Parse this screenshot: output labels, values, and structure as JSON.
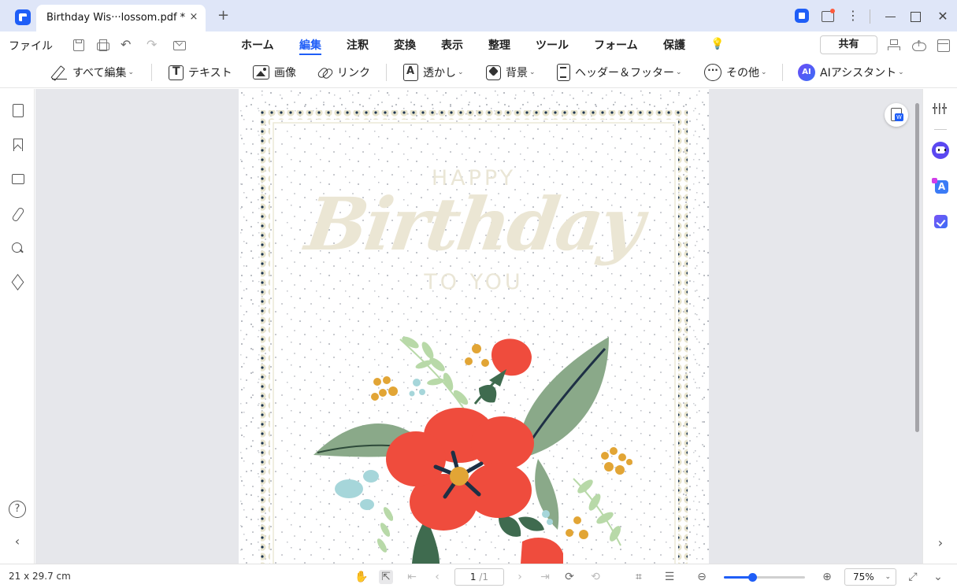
{
  "window": {
    "tab_title": "Birthday  Wis···lossom.pdf *",
    "tab_close": "×",
    "new_tab": "+"
  },
  "menu": {
    "file": "ファイル",
    "tabs": [
      {
        "label": "ホーム",
        "active": false
      },
      {
        "label": "編集",
        "active": true
      },
      {
        "label": "注釈",
        "active": false
      },
      {
        "label": "変換",
        "active": false
      },
      {
        "label": "表示",
        "active": false
      },
      {
        "label": "整理",
        "active": false
      },
      {
        "label": "ツール",
        "active": false
      },
      {
        "label": "フォーム",
        "active": false
      },
      {
        "label": "保護",
        "active": false
      }
    ],
    "share": "共有"
  },
  "ribbon": {
    "edit_all": "すべて編集",
    "text": "テキスト",
    "image": "画像",
    "link": "リンク",
    "watermark": "透かし",
    "background": "背景",
    "header_footer": "ヘッダー＆フッター",
    "more": "その他",
    "ai_assistant": "AIアシスタント",
    "ai_badge": "AI",
    "chevron": "⌄"
  },
  "document": {
    "happy": "HAPPY",
    "birthday": "Birthday",
    "to_you": "TO YOU"
  },
  "status": {
    "page_size": "21 x 29.7 cm",
    "current_page": "1",
    "total_pages": "/1",
    "zoom": "75%",
    "zoom_level": 0.35
  },
  "colors": {
    "accent": "#1f5ef7",
    "flower_red": "#ef4c3d",
    "leaf_green": "#8aa989",
    "dark_leaf": "#3f6b4f",
    "gold": "#e2a535",
    "light_blue": "#a6d6da",
    "border_cream": "#e9e4cf"
  },
  "icons": [
    "app-logo-icon",
    "pdf-icon",
    "message-icon",
    "kebab-icon",
    "save-icon",
    "print-icon",
    "undo-icon",
    "redo-icon",
    "mail-icon",
    "bulb-icon",
    "org-icon",
    "cloud-upload-icon",
    "collapse-icon",
    "page-icon",
    "bookmark-icon",
    "comment-icon",
    "attachment-icon",
    "search-icon",
    "layers-icon",
    "help-icon",
    "properties-icon",
    "ai-robot-icon",
    "translate-icon",
    "task-icon",
    "convert-word-icon",
    "hand-icon",
    "select-icon",
    "zoom-out-icon",
    "zoom-in-icon",
    "fit-icon"
  ]
}
